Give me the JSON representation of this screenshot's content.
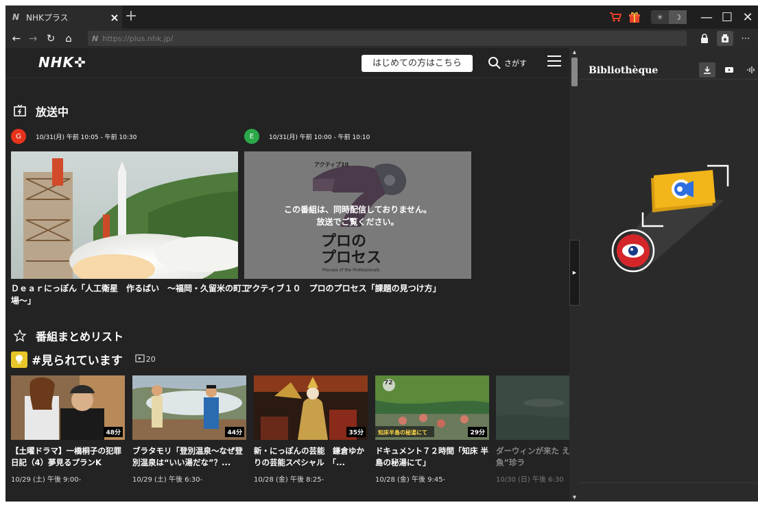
{
  "browser": {
    "tab_title": "NHKプラス",
    "tab_favicon": "N",
    "close_tab": "×",
    "new_tab": "+",
    "url": "https://plus.nhk.jp/",
    "url_icon": "N",
    "theme_light_icon": "☀",
    "theme_dark_icon": "☽",
    "window_minimize": "—",
    "window_maximize": "☐",
    "window_close": "✕",
    "more": "⋯"
  },
  "site": {
    "logo": "NHK✜",
    "first_time_button": "はじめての方はこちら",
    "search_label": "さがす"
  },
  "live": {
    "section_title": "放送中",
    "items": [
      {
        "channel": "G",
        "channel_color": "#e8331c",
        "time": "10/31(月) 午前 10:05 - 午前 10:30",
        "title": "Ｄｅａｒにっぽん「人工衛星　作るばい　～福岡・久留米の町工場～」"
      },
      {
        "channel": "E",
        "channel_color": "#2aa84a",
        "time": "10/31(月) 午前 10:00 - 午前 10:10",
        "title": "アクティブ１０　プロのプロセス「課題の見つけ方」",
        "overlay": "この番組は、同時配信しておりません。\n放送でご覧ください。",
        "thumb_label_small": "アクティブ10",
        "thumb_label_big_1": "プロの",
        "thumb_label_big_2": "プロセス",
        "thumb_label_en": "Process of the Professionals"
      }
    ]
  },
  "lists": {
    "section_title": "番組まとめリスト",
    "list_name": "#見られています",
    "list_count": "20",
    "cards": [
      {
        "title": "【土曜ドラマ】一橋桐子の犯罪日記（4）夢見るプランK",
        "date": "10/29 (土) 午後 9:00-",
        "duration": "48分"
      },
      {
        "title": "ブラタモリ「登別温泉～なぜ登別温泉は“いい湯だな”？...",
        "date": "10/29 (土) 午後 6:30-",
        "duration": "44分"
      },
      {
        "title": "新・にっぽんの芸能　鎌倉ゆかりの芸能スペシャル　「...",
        "date": "10/28 (金) 午後 8:25-",
        "duration": "35分"
      },
      {
        "title": "ドキュメント７２時間「知床 半島の秘湯にて」",
        "date": "10/28 (金) 午後 9:45-",
        "duration": "29分",
        "thumb_caption": "知床半島の秘湯にて",
        "thumb_num": "72"
      },
      {
        "title": "ダーウィンが来た える“砂の魚”珍ラ",
        "date": "10/30 (日) 午後 6:30",
        "duration": ""
      }
    ]
  },
  "library": {
    "title": "Bibliothèque"
  }
}
